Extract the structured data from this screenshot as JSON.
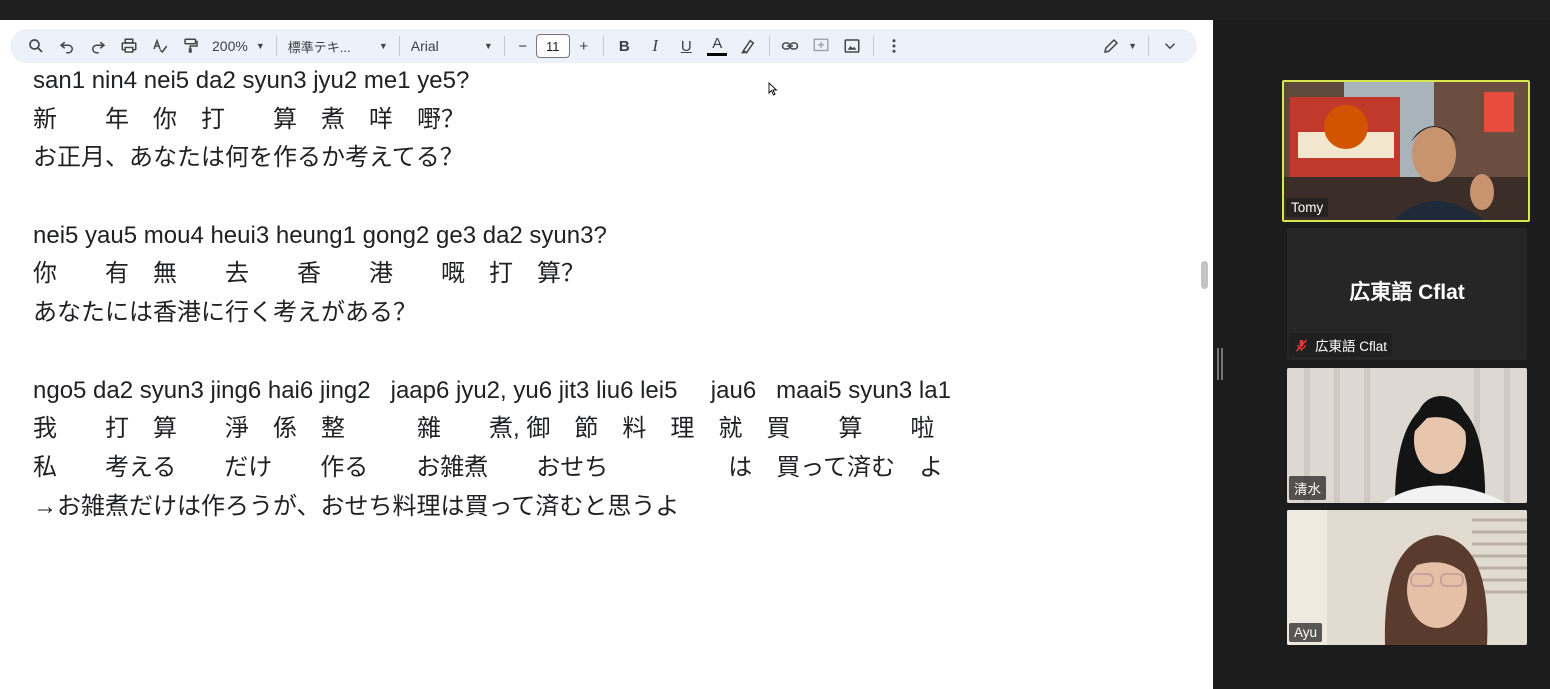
{
  "toolbar": {
    "zoom": "200%",
    "style": "標準テキ...",
    "font": "Arial",
    "font_size": "11",
    "minus": "−",
    "plus": "+",
    "bold": "B",
    "italic": "I",
    "underline": "U",
    "text_color": "A"
  },
  "document": {
    "lines": [
      "san1 nin4 nei5 da2 syun3 jyu2 me1 ye5?",
      "新　　年　你　打　　算　煮　咩　嘢？",
      "お正月、あなたは何を作るか考えてる？",
      "",
      "nei5 yau5 mou4 heui3 heung1 gong2 ge3 da2 syun3?",
      "你　　有　無　　去　　香　　港　　嘅　打　算？",
      "あなたには香港に行く考えがある？",
      "",
      "ngo5 da2 syun3 jing6 hai6 jing2   jaap6 jyu2, yu6 jit3 liu6 lei5     jau6   maai5 syun3 la1",
      "我　　打　算　　淨　係　整　　　雜　　煮, 御　節　料　理　就　買　　算　　啦",
      "私　　考える　　だけ　　作る　　お雑煮　　おせち　　　　　は　買って済む　よ",
      "→お雑煮だけは作ろうが、おせち料理は買って済むと思うよ"
    ]
  },
  "participants": {
    "tomy": {
      "name": "Tomy"
    },
    "cflat": {
      "title": "広東語 Cflat",
      "name": "広東語 Cflat"
    },
    "shimizu": {
      "name": "清水"
    },
    "ayu": {
      "name": "Ayu"
    }
  },
  "colors": {
    "active_speaker_border": "#d7e84f",
    "toolbar_bg": "#edf2fa",
    "muted_icon": "#e53935"
  }
}
